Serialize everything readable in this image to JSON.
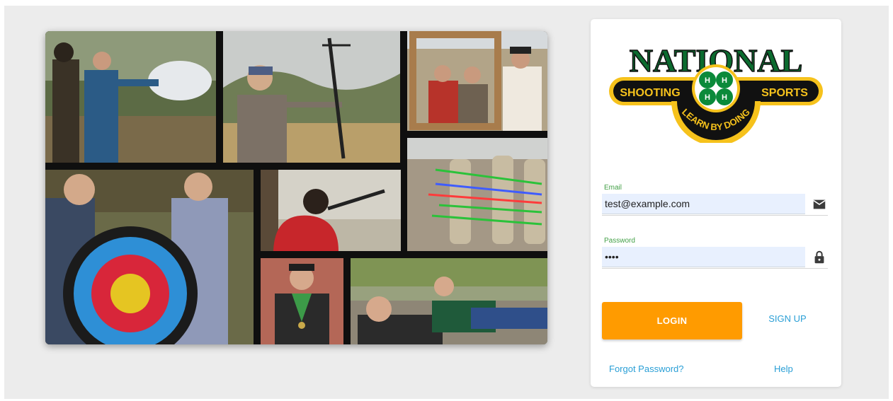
{
  "logo": {
    "word_top": "NATIONAL",
    "left_text": "SHOOTING",
    "right_text": "SPORTS",
    "tagline": "LEARN BY DOING",
    "colors": {
      "green": "#0b6b2f",
      "gold": "#f6c21c",
      "black": "#111111"
    }
  },
  "form": {
    "email": {
      "label": "Email",
      "value": "test@example.com",
      "icon": "mail-icon"
    },
    "password": {
      "label": "Password",
      "value": "••••",
      "icon": "lock-icon"
    },
    "login_label": "LOGIN",
    "signup_label": "SIGN UP",
    "forgot_label": "Forgot Password?",
    "help_label": "Help"
  },
  "colors": {
    "accent": "#ff9b00",
    "link": "#2a9fd6",
    "label_green": "#43a047",
    "input_bg": "#e8f0fe",
    "page_bg": "#ececec"
  }
}
